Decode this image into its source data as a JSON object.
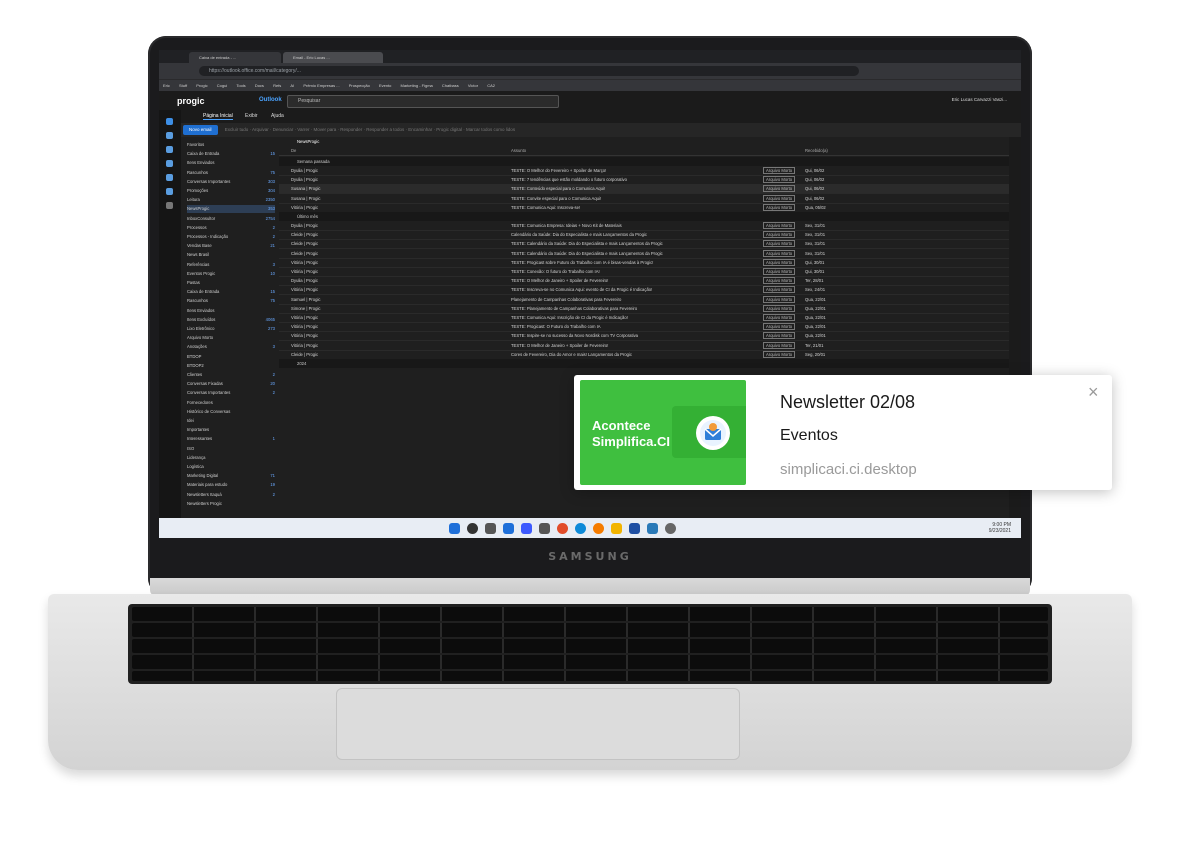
{
  "browser": {
    "tabs": [
      "Caixa de entrada - ...",
      "Email - Eric Lucas ..."
    ],
    "url": "https://outlook.office.com/mail/category/...",
    "bookmarks": [
      "Eric",
      "Stuff",
      "Progic",
      "Cogui",
      "Tools",
      "Docs",
      "Refs",
      "AI",
      "Prêmio Empresas ...",
      "Prospecção",
      "Evento",
      "Marketing - Figma",
      "Chatbass",
      "Victor",
      "CA2"
    ]
  },
  "outlook": {
    "brand": "progic",
    "app": "Outlook",
    "search_placeholder": "Pesquisar",
    "user": "Eric Lucas Carvazzi Vaszi...",
    "tabs": [
      "Página Inicial",
      "Exibir",
      "Ajuda"
    ],
    "new_mail": "Novo email",
    "ribbon": "Excluir tudo  ·  Arquivar  ·  Denunciar  ·  Varrer  ·  Mover para  ·  Responder  ·  Responder a todos  ·  Encaminhar  ·  Progic digital  ·  Marcar todos como lidos"
  },
  "folders": [
    {
      "label": "Favoritos",
      "count": ""
    },
    {
      "label": "Caixa de Entrada",
      "count": "15"
    },
    {
      "label": "Itens Enviados",
      "count": ""
    },
    {
      "label": "Rascunhos",
      "count": "75"
    },
    {
      "label": "Conversas Importantes",
      "count": "303"
    },
    {
      "label": "Promoções",
      "count": "304"
    },
    {
      "label": "Leitura",
      "count": "2350"
    },
    {
      "label": "NewsProgic",
      "count": "353"
    },
    {
      "label": "InboxConsultor",
      "count": "2754"
    },
    {
      "label": "Processos",
      "count": "2"
    },
    {
      "label": "Processos - Indicação",
      "count": "2"
    },
    {
      "label": "Vendas Base",
      "count": "21"
    },
    {
      "label": "News Brasil",
      "count": ""
    },
    {
      "label": "Referências",
      "count": "3"
    },
    {
      "label": "Eventos Progic",
      "count": "10"
    },
    {
      "label": "Pastas",
      "count": ""
    },
    {
      "label": "Caixa de Entrada",
      "count": "15"
    },
    {
      "label": "Rascunhos",
      "count": "75"
    },
    {
      "label": "Itens Enviados",
      "count": ""
    },
    {
      "label": "Itens Excluídos",
      "count": "4065"
    },
    {
      "label": "Lixo Eletrônico",
      "count": "273"
    },
    {
      "label": "Arquivo Morto",
      "count": ""
    },
    {
      "label": "Anotações",
      "count": "3"
    },
    {
      "label": "BTDOP",
      "count": ""
    },
    {
      "label": "BTDOP2",
      "count": ""
    },
    {
      "label": "Clientes",
      "count": "2"
    },
    {
      "label": "Conversas Fixadas",
      "count": "20"
    },
    {
      "label": "Conversas Importantes",
      "count": "2"
    },
    {
      "label": "Fornecedores",
      "count": ""
    },
    {
      "label": "Histórico de Conversas",
      "count": ""
    },
    {
      "label": "Idei",
      "count": ""
    },
    {
      "label": "Importantes",
      "count": ""
    },
    {
      "label": "Interessantes",
      "count": "1"
    },
    {
      "label": "ISO",
      "count": ""
    },
    {
      "label": "Liderança",
      "count": ""
    },
    {
      "label": "Logística",
      "count": ""
    },
    {
      "label": "Marketing Digital",
      "count": "71"
    },
    {
      "label": "Materiais para estudo",
      "count": "19"
    },
    {
      "label": "Newsletters Itaquá",
      "count": "2"
    },
    {
      "label": "Newsletters Progic",
      "count": ""
    }
  ],
  "list": {
    "category": "NewsProgic",
    "col_from": "De",
    "col_subject": "Assunto",
    "col_received": "Recebido(a)",
    "groups": [
      "Semana passada",
      "Último mês",
      "2024"
    ],
    "rows": [
      {
        "from": "Dyulia | Progic",
        "subject": "TESTE: O Melhor do Fevereiro + Spoiler de Março!",
        "tag": "Arquivo Morto",
        "date": "Qui, 06/02"
      },
      {
        "from": "Dyulia | Progic",
        "subject": "TESTE: 7 tendências que estão moldando o futuro corporativo",
        "tag": "Arquivo Morto",
        "date": "Qui, 06/02"
      },
      {
        "from": "Susana | Progic",
        "subject": "TESTE: Conteúdo especial para o Comunica Aqui!",
        "tag": "Arquivo Morto",
        "date": "Qui, 06/02"
      },
      {
        "from": "Susana | Progic",
        "subject": "TESTE: Convite especial para o Comunica Aqui!",
        "tag": "Arquivo Morto",
        "date": "Qui, 06/02"
      },
      {
        "from": "Vitória | Progic",
        "subject": "TESTE: Comunica Aqui: Inscreva-se!",
        "tag": "Arquivo Morto",
        "date": "Qua, 05/02"
      },
      {
        "from": "Dyulia | Progic",
        "subject": "TESTE: Comunica Empresa: Ideias + Novo Kit de Materiais",
        "tag": "Arquivo Morto",
        "date": "Sex, 31/01"
      },
      {
        "from": "Cleide | Progic",
        "subject": "Calendário da Saúde: Dia do Especialista e mais Lançamentos da Progic",
        "tag": "Arquivo Morto",
        "date": "Sex, 31/01"
      },
      {
        "from": "Cleide | Progic",
        "subject": "TESTE: Calendário da Saúde: Dia do Especialista e mais Lançamentos da Progic",
        "tag": "Arquivo Morto",
        "date": "Sex, 31/01"
      },
      {
        "from": "Cleide | Progic",
        "subject": "TESTE: Calendário da Saúde: Dia do Especialista e mais Lançamentos da Progic",
        "tag": "Arquivo Morto",
        "date": "Sex, 31/01"
      },
      {
        "from": "Vitória | Progic",
        "subject": "TESTE: Progicast sobre Futuro do Trabalho com IA é bisas-vendas à Progic!",
        "tag": "Arquivo Morto",
        "date": "Qui, 30/01"
      },
      {
        "from": "Vitória | Progic",
        "subject": "TESTE: Conexão: O futuro do Trabalho com IA!",
        "tag": "Arquivo Morto",
        "date": "Qui, 30/01"
      },
      {
        "from": "Dyulia | Progic",
        "subject": "TESTE: O Melhor de Janeiro + Spoiler de Fevereiro!",
        "tag": "Arquivo Morto",
        "date": "Ter, 28/01"
      },
      {
        "from": "Vitória | Progic",
        "subject": "TESTE: Inscreva-se no Comunica Aqui: evento de CI da Progic é Indicação!",
        "tag": "Arquivo Morto",
        "date": "Sex, 24/01"
      },
      {
        "from": "Samuel | Progic",
        "subject": "Planejamento de Campanhas Colaborativas para Fevereiro",
        "tag": "Arquivo Morto",
        "date": "Qua, 22/01"
      },
      {
        "from": "Simone | Progic",
        "subject": "TESTE: Planejamento de Campanhas Colaborativas para Fevereiro",
        "tag": "Arquivo Morto",
        "date": "Qua, 22/01"
      },
      {
        "from": "Vitória | Progic",
        "subject": "TESTE: Comunica Aqui: Inscrição de CI da Progic é Indicação!",
        "tag": "Arquivo Morto",
        "date": "Qua, 22/01"
      },
      {
        "from": "Vitória | Progic",
        "subject": "TESTE: Progicast: O Futuro do Trabalho com IA",
        "tag": "Arquivo Morto",
        "date": "Qua, 22/01"
      },
      {
        "from": "Vitória | Progic",
        "subject": "TESTE: Inspire-se no sucesso da Novo Nordisk com TV Corporativa",
        "tag": "Arquivo Morto",
        "date": "Qua, 22/01"
      },
      {
        "from": "Vitória | Progic",
        "subject": "TESTE: O Melhor de Janeiro + Spoiler de Fevereiro!",
        "tag": "Arquivo Morto",
        "date": "Ter, 21/01"
      },
      {
        "from": "Cleide | Progic",
        "subject": "Cores de Fevereiro, Dia do Amor e mais! Lançamentos da Progic",
        "tag": "Arquivo Morto",
        "date": "Seg, 20/01"
      }
    ]
  },
  "taskbar": {
    "time": "9:00 PM",
    "date": "9/23/2021"
  },
  "toast": {
    "image_brand": "Acontece Simplifica.CI",
    "title": "Newsletter 02/08",
    "body": "Eventos",
    "source": "simplicaci.ci.desktop",
    "close_glyph": "×"
  },
  "device": {
    "brand": "SAMSUNG"
  },
  "colors": {
    "toast_green": "#3fbf3f",
    "outlook_accent": "#1f6fd1",
    "dark_bg": "#1f1f1f"
  }
}
